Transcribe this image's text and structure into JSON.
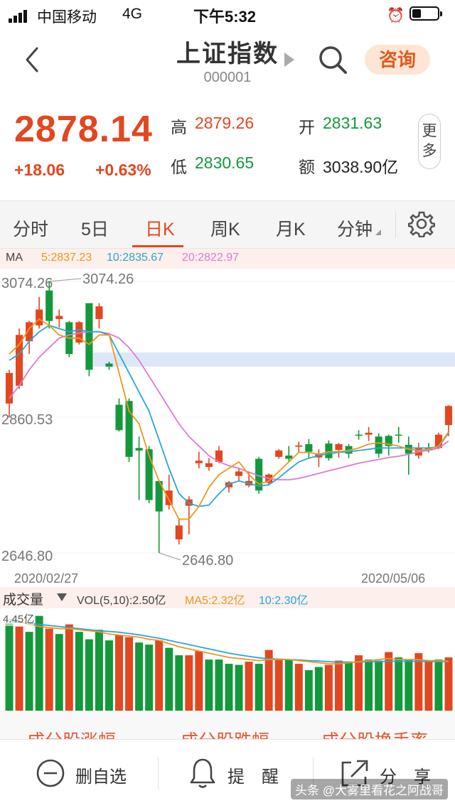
{
  "status": {
    "carrier": "中国移动",
    "network": "4G",
    "time": "下午5:32",
    "battery_level": 0.35
  },
  "nav": {
    "title": "上证指数",
    "code": "000001",
    "consult_label": "咨询"
  },
  "quote": {
    "price": "2878.14",
    "change": "+18.06",
    "change_pct": "+0.63%",
    "high_label": "高",
    "high": "2879.26",
    "open_label": "开",
    "open": "2831.63",
    "low_label": "低",
    "low": "2830.65",
    "amount_label": "额",
    "amount": "3038.90亿",
    "more_label_1": "更",
    "more_label_2": "多"
  },
  "tabs": [
    {
      "label": "分时"
    },
    {
      "label": "5日"
    },
    {
      "label": "日K"
    },
    {
      "label": "周K"
    },
    {
      "label": "月K"
    },
    {
      "label": "分钟"
    }
  ],
  "active_tab": "日K",
  "ma": {
    "label": "MA",
    "ma5": "5:2837.23",
    "ma10": "10:2835.67",
    "ma20": "20:2822.97"
  },
  "chart_labels": {
    "y_top": "3074.26",
    "y_mid": "2860.53",
    "y_bottom": "2646.80",
    "max_callout": "3074.26",
    "min_callout": "2646.80",
    "date_start": "2020/02/27",
    "date_end": "2020/05/06"
  },
  "volume": {
    "title": "成交量",
    "vol": "VOL(5,10):2.50亿",
    "ma5": "MA5:2.32亿",
    "ma10": "10:2.30亿",
    "axis_label": "4.45亿"
  },
  "colors": {
    "up": "#e2471f",
    "down": "#13993b",
    "ma5": "#f0961e",
    "ma10": "#2aa6d8",
    "ma20": "#e078d6"
  },
  "bottom_tabs": [
    "成分股涨幅",
    "成分股跌幅",
    "成分股换手率"
  ],
  "bottom_bar": {
    "remove_label": "删自选",
    "remind_label": "提　醒",
    "share_label": "分　享"
  },
  "watermark": "头条 @大雾里看花之阿战哥",
  "chart_data": {
    "type": "candlestick",
    "x_range": [
      "2020/02/27",
      "2020/05/06"
    ],
    "y_range": [
      2646.8,
      3074.26
    ],
    "max_mark": 3074.26,
    "min_mark": 2646.8,
    "candles": [
      {
        "o": 2882,
        "c": 2930,
        "h": 2935,
        "l": 2860
      },
      {
        "o": 2910,
        "c": 2990,
        "h": 3000,
        "l": 2905
      },
      {
        "o": 2980,
        "c": 3010,
        "h": 3012,
        "l": 2960
      },
      {
        "o": 3005,
        "c": 3030,
        "h": 3050,
        "l": 3000
      },
      {
        "o": 3060,
        "c": 3012,
        "h": 3074.26,
        "l": 3000
      },
      {
        "o": 3015,
        "c": 3020,
        "h": 3030,
        "l": 3002
      },
      {
        "o": 3010,
        "c": 2960,
        "h": 3012,
        "l": 2955
      },
      {
        "o": 2978,
        "c": 3010,
        "h": 3012,
        "l": 2975
      },
      {
        "o": 3040,
        "c": 2935,
        "h": 3040,
        "l": 2925
      },
      {
        "o": 3015,
        "c": 3035,
        "h": 3040,
        "l": 3000
      },
      {
        "o": 2945,
        "c": 2940,
        "h": 2948,
        "l": 2935
      },
      {
        "o": 2880,
        "c": 2840,
        "h": 2890,
        "l": 2838
      },
      {
        "o": 2886,
        "c": 2798,
        "h": 2890,
        "l": 2790
      },
      {
        "o": 2812,
        "c": 2808,
        "h": 2830,
        "l": 2730
      },
      {
        "o": 2810,
        "c": 2730,
        "h": 2815,
        "l": 2725
      },
      {
        "o": 2760,
        "c": 2712,
        "h": 2762,
        "l": 2646.8
      },
      {
        "o": 2722,
        "c": 2745,
        "h": 2770,
        "l": 2715
      },
      {
        "o": 2668,
        "c": 2690,
        "h": 2700,
        "l": 2660
      },
      {
        "o": 2721,
        "c": 2731,
        "h": 2736,
        "l": 2676
      },
      {
        "o": 2788,
        "c": 2792,
        "h": 2806,
        "l": 2780
      },
      {
        "o": 2782,
        "c": 2788,
        "h": 2796,
        "l": 2776
      },
      {
        "o": 2790,
        "c": 2808,
        "h": 2815,
        "l": 2788
      },
      {
        "o": 2750,
        "c": 2758,
        "h": 2760,
        "l": 2742
      },
      {
        "o": 2768,
        "c": 2775,
        "h": 2780,
        "l": 2760
      },
      {
        "o": 2753,
        "c": 2760,
        "h": 2775,
        "l": 2750
      },
      {
        "o": 2795,
        "c": 2745,
        "h": 2798,
        "l": 2740
      },
      {
        "o": 2757,
        "c": 2770,
        "h": 2772,
        "l": 2755
      },
      {
        "o": 2798,
        "c": 2808,
        "h": 2810,
        "l": 2795
      },
      {
        "o": 2800,
        "c": 2795,
        "h": 2815,
        "l": 2790
      },
      {
        "o": 2814,
        "c": 2816,
        "h": 2822,
        "l": 2806
      },
      {
        "o": 2818,
        "c": 2806,
        "h": 2826,
        "l": 2795
      },
      {
        "o": 2797,
        "c": 2803,
        "h": 2810,
        "l": 2782
      },
      {
        "o": 2819,
        "c": 2796,
        "h": 2824,
        "l": 2792
      },
      {
        "o": 2809,
        "c": 2818,
        "h": 2820,
        "l": 2797
      },
      {
        "o": 2815,
        "c": 2803,
        "h": 2818,
        "l": 2796
      },
      {
        "o": 2833,
        "c": 2832,
        "h": 2840,
        "l": 2825
      },
      {
        "o": 2833,
        "c": 2836,
        "h": 2845,
        "l": 2823
      },
      {
        "o": 2830,
        "c": 2803,
        "h": 2835,
        "l": 2797
      },
      {
        "o": 2831,
        "c": 2815,
        "h": 2833,
        "l": 2800
      },
      {
        "o": 2833,
        "c": 2832,
        "h": 2845,
        "l": 2820
      },
      {
        "o": 2817,
        "c": 2803,
        "h": 2830,
        "l": 2770
      },
      {
        "o": 2800,
        "c": 2812,
        "h": 2820,
        "l": 2795
      },
      {
        "o": 2813,
        "c": 2808,
        "h": 2820,
        "l": 2805
      },
      {
        "o": 2812,
        "c": 2833,
        "h": 2836,
        "l": 2810
      },
      {
        "o": 2848,
        "c": 2878.14,
        "h": 2879.26,
        "l": 2830.65
      }
    ],
    "ma5": [
      2960,
      2975,
      3000,
      3015,
      3005,
      2990,
      2985,
      2985,
      2975,
      2990,
      2990,
      2930,
      2870,
      2850,
      2800,
      2760,
      2730,
      2700,
      2700,
      2720,
      2750,
      2770,
      2780,
      2790,
      2770,
      2755,
      2760,
      2775,
      2790,
      2805,
      2805,
      2802,
      2806,
      2806,
      2808,
      2812,
      2818,
      2820,
      2818,
      2815,
      2810,
      2808,
      2810,
      2815,
      2837.23
    ],
    "ma10": [
      2950,
      2960,
      2980,
      2995,
      3005,
      3000,
      2995,
      2998,
      2995,
      2995,
      2990,
      2960,
      2930,
      2900,
      2870,
      2825,
      2780,
      2740,
      2725,
      2720,
      2722,
      2740,
      2755,
      2760,
      2756,
      2752,
      2754,
      2765,
      2778,
      2790,
      2796,
      2800,
      2803,
      2805,
      2806,
      2808,
      2810,
      2812,
      2812,
      2812,
      2812,
      2812,
      2812,
      2814,
      2835.67
    ],
    "ma20": [
      2890,
      2910,
      2935,
      2955,
      2970,
      2985,
      2990,
      2993,
      2995,
      2995,
      2992,
      2985,
      2970,
      2950,
      2925,
      2900,
      2875,
      2850,
      2830,
      2815,
      2800,
      2790,
      2784,
      2780,
      2774,
      2768,
      2764,
      2762,
      2762,
      2764,
      2768,
      2772,
      2776,
      2780,
      2784,
      2788,
      2791,
      2794,
      2797,
      2799,
      2802,
      2806,
      2808,
      2812,
      2822.97
    ],
    "volume": [
      {
        "v": 4.1,
        "up": false
      },
      {
        "v": 3.95,
        "up": true
      },
      {
        "v": 3.7,
        "up": false
      },
      {
        "v": 4.45,
        "up": false
      },
      {
        "v": 3.85,
        "up": true
      },
      {
        "v": 3.6,
        "up": false
      },
      {
        "v": 4.05,
        "up": true
      },
      {
        "v": 3.7,
        "up": false
      },
      {
        "v": 3.35,
        "up": false
      },
      {
        "v": 3.8,
        "up": false
      },
      {
        "v": 3.3,
        "up": false
      },
      {
        "v": 3.55,
        "up": true
      },
      {
        "v": 3.45,
        "up": true
      },
      {
        "v": 3.2,
        "up": false
      },
      {
        "v": 3.1,
        "up": false
      },
      {
        "v": 3.3,
        "up": true
      },
      {
        "v": 2.95,
        "up": false
      },
      {
        "v": 2.6,
        "up": false
      },
      {
        "v": 2.6,
        "up": true
      },
      {
        "v": 2.8,
        "up": true
      },
      {
        "v": 2.4,
        "up": false
      },
      {
        "v": 2.4,
        "up": false
      },
      {
        "v": 2.2,
        "up": false
      },
      {
        "v": 2.15,
        "up": false
      },
      {
        "v": 2.3,
        "up": true
      },
      {
        "v": 2.2,
        "up": false
      },
      {
        "v": 2.85,
        "up": true
      },
      {
        "v": 2.4,
        "up": true
      },
      {
        "v": 2.4,
        "up": false
      },
      {
        "v": 2.2,
        "up": true
      },
      {
        "v": 1.9,
        "up": false
      },
      {
        "v": 2.05,
        "up": false
      },
      {
        "v": 2.15,
        "up": true
      },
      {
        "v": 2.35,
        "up": true
      },
      {
        "v": 2.3,
        "up": false
      },
      {
        "v": 2.6,
        "up": true
      },
      {
        "v": 2.4,
        "up": false
      },
      {
        "v": 2.35,
        "up": false
      },
      {
        "v": 2.75,
        "up": true
      },
      {
        "v": 2.5,
        "up": false
      },
      {
        "v": 2.4,
        "up": false
      },
      {
        "v": 2.7,
        "up": true
      },
      {
        "v": 2.3,
        "up": true
      },
      {
        "v": 2.4,
        "up": false
      },
      {
        "v": 2.5,
        "up": true
      }
    ],
    "vol_ma5": [
      4.3,
      4.2,
      4.05,
      3.95,
      3.9,
      3.85,
      3.85,
      3.8,
      3.75,
      3.7,
      3.6,
      3.55,
      3.5,
      3.45,
      3.35,
      3.3,
      3.15,
      3.0,
      2.9,
      2.8,
      2.7,
      2.6,
      2.5,
      2.45,
      2.4,
      2.35,
      2.4,
      2.4,
      2.4,
      2.35,
      2.3,
      2.25,
      2.2,
      2.2,
      2.25,
      2.3,
      2.35,
      2.4,
      2.45,
      2.4,
      2.4,
      2.4,
      2.35,
      2.35,
      2.32
    ],
    "vol_ma10": [
      4.2,
      4.15,
      4.1,
      4.05,
      4.0,
      3.95,
      3.9,
      3.85,
      3.8,
      3.75,
      3.72,
      3.68,
      3.62,
      3.56,
      3.48,
      3.4,
      3.3,
      3.2,
      3.1,
      3.0,
      2.9,
      2.8,
      2.7,
      2.62,
      2.55,
      2.48,
      2.44,
      2.42,
      2.4,
      2.38,
      2.35,
      2.33,
      2.3,
      2.28,
      2.28,
      2.28,
      2.3,
      2.3,
      2.32,
      2.32,
      2.32,
      2.32,
      2.31,
      2.3,
      2.3
    ]
  }
}
